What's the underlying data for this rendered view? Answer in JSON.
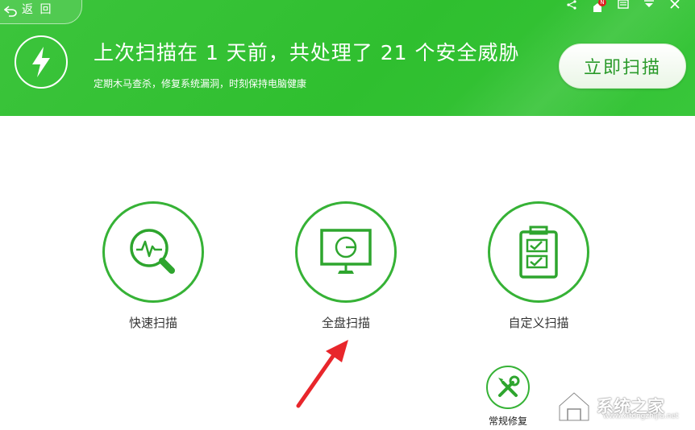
{
  "header": {
    "back_label": "返 回",
    "title": "上次扫描在 1 天前，共处理了 21 个安全威胁",
    "subtitle": "定期木马查杀，修复系统漏洞，时刻保持电脑健康",
    "scan_now_label": "立即扫描",
    "colors": {
      "bg": "#33c233",
      "accent": "#2a9a2a"
    }
  },
  "top_icons": [
    "share-icon",
    "notification-icon",
    "menu-icon",
    "dropdown-icon",
    "close-icon"
  ],
  "scan_options": [
    {
      "label": "快速扫描",
      "icon": "quick-scan-magnifier-icon"
    },
    {
      "label": "全盘扫描",
      "icon": "monitor-scan-icon"
    },
    {
      "label": "自定义扫描",
      "icon": "clipboard-check-icon"
    }
  ],
  "repair": {
    "label": "常规修复",
    "icon": "tools-icon"
  },
  "watermark": {
    "text": "系统之家",
    "url": "www.xitongzhijia.net"
  }
}
